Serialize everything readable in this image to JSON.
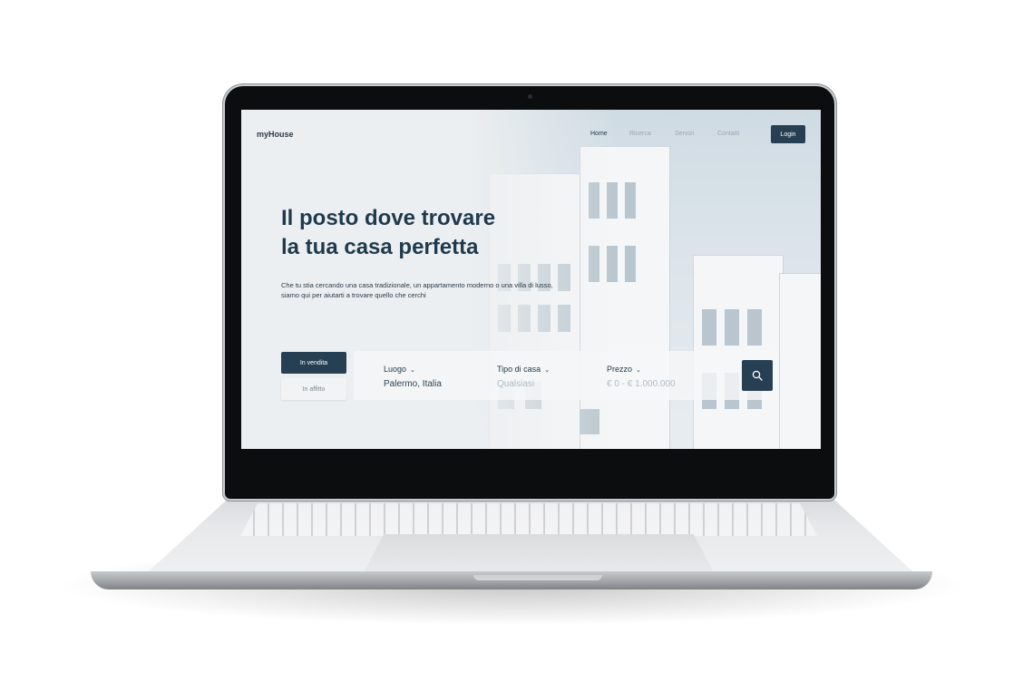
{
  "brand": "myHouse",
  "nav": {
    "items": [
      {
        "label": "Home",
        "active": true
      },
      {
        "label": "Ricerca",
        "active": false
      },
      {
        "label": "Servizi",
        "active": false
      },
      {
        "label": "Contatti",
        "active": false
      }
    ],
    "login": "Login"
  },
  "hero": {
    "headline_line1": "Il posto dove trovare",
    "headline_line2": "la tua casa perfetta",
    "subtitle_line1": "Che tu stia cercando una casa tradizionale, un appartamento moderno o una villa di lusso,",
    "subtitle_line2": "siamo qui per aiutarti a trovare quello che cerchi"
  },
  "tabs": {
    "sale": "In vendita",
    "rent": "In affitto",
    "selected": "sale"
  },
  "search": {
    "location": {
      "label": "Luogo",
      "value": "Palermo, Italia"
    },
    "type": {
      "label": "Tipo di casa",
      "value": "Qualsiasi"
    },
    "price": {
      "label": "Prezzo",
      "value": "€ 0 - € 1.000.000"
    },
    "button_icon": "search-icon"
  },
  "colors": {
    "accent": "#263f52",
    "heading": "#1f3a4d",
    "muted": "#9aa7b1"
  }
}
